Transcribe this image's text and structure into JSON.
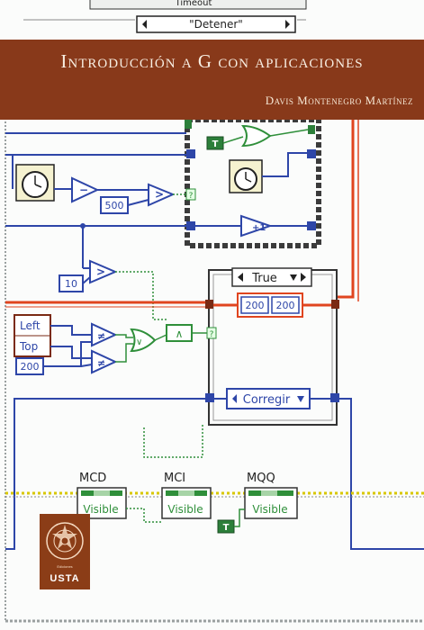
{
  "book": {
    "title": "Introducción a G con aplicaciones",
    "author": "Davis Montenegro Martínez"
  },
  "publisher": {
    "name": "USTA",
    "arc_text": "Ediciones"
  },
  "diagram": {
    "top_selector": "\"Detener\"",
    "top_partial_label": "Timeout",
    "case_selector": "True",
    "constants": {
      "const_500": "500",
      "const_10": "10",
      "const_200a": "200",
      "const_200b": "200",
      "const_200_left": "200"
    },
    "bool_true_labels": [
      "T",
      "T"
    ],
    "unbundle_items": [
      "Left",
      "Top"
    ],
    "enum_value": "Corregir",
    "property_nodes": [
      {
        "name": "MCD",
        "property": "Visible"
      },
      {
        "name": "MCI",
        "property": "Visible"
      },
      {
        "name": "MQQ",
        "property": "Visible"
      }
    ],
    "question_marks": [
      "?",
      "?"
    ],
    "colors": {
      "banner": "#88391a",
      "wire_blue": "#2e46a8",
      "wire_orange": "#e0451f",
      "wire_green": "#2f8f3a",
      "wire_yellow": "#d8c700"
    }
  }
}
